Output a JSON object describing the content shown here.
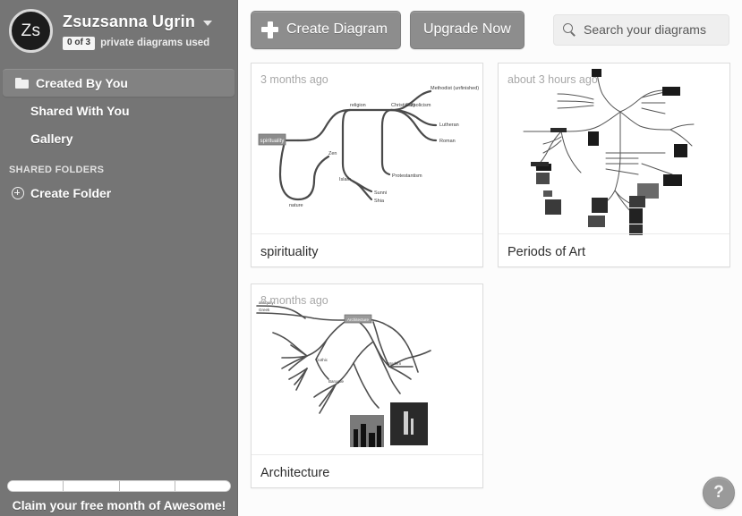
{
  "sidebar": {
    "avatar_initials": "Zs",
    "user_name": "Zsuzsanna Ugrin",
    "caret_icon": "chevron-down-icon",
    "quota_badge": "0 of 3",
    "quota_label": "private diagrams used",
    "nav": [
      {
        "label": "Created By You",
        "icon": "folder-icon",
        "active": true
      },
      {
        "label": "Shared With You",
        "icon": null,
        "active": false
      },
      {
        "label": "Gallery",
        "icon": null,
        "active": false
      }
    ],
    "section_label": "SHARED FOLDERS",
    "create_folder": {
      "label": "Create Folder",
      "icon": "plus-circle-icon"
    },
    "promo": {
      "text": "Claim your free month of Awesome!",
      "segments": 4,
      "segments_filled": 0
    },
    "bg_color": "#757575"
  },
  "toolbar": {
    "create_label": "Create Diagram",
    "create_icon": "plus-icon",
    "upgrade_label": "Upgrade Now",
    "search": {
      "placeholder": "Search your diagrams",
      "value": "",
      "icon": "search-icon"
    },
    "button_color": "#8d8d8d"
  },
  "cards": [
    {
      "time": "3 months ago",
      "title": "spirituality",
      "thumb": "mindmap-spirituality"
    },
    {
      "time": "about 3 hours ago",
      "title": "Periods of Art",
      "thumb": "mindmap-periods-of-art"
    },
    {
      "time": "8 months ago",
      "title": "Architecture",
      "thumb": "mindmap-architecture"
    }
  ],
  "help": {
    "label": "?"
  }
}
